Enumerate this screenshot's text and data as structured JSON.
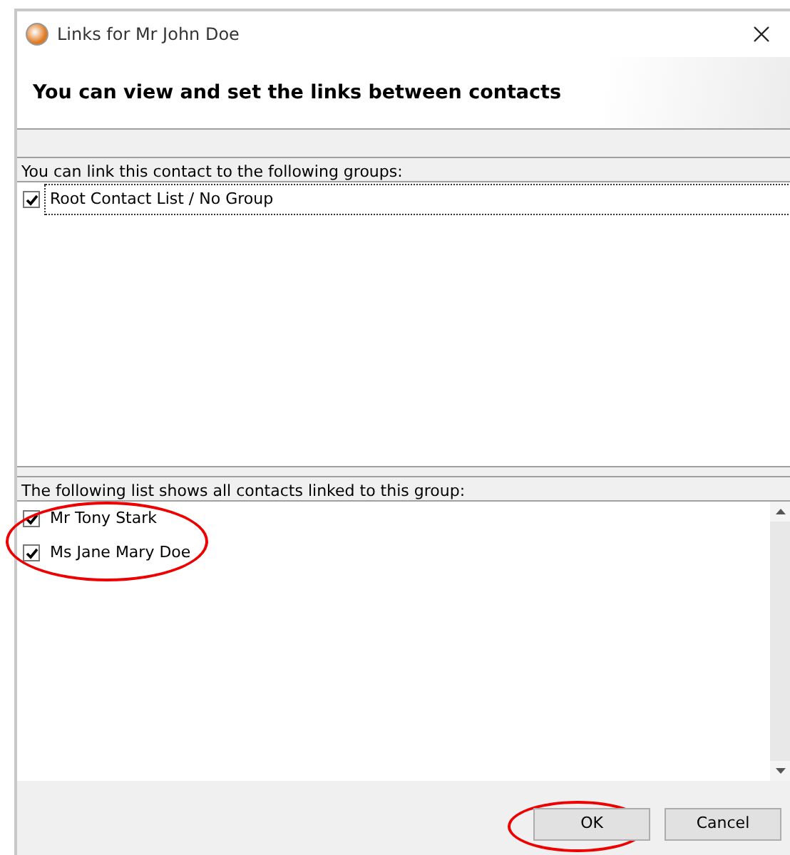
{
  "window": {
    "title": "Links for Mr John Doe"
  },
  "header": {
    "title": "You can view and set the links between contacts"
  },
  "groups": {
    "label": "You can link this contact to the following groups:",
    "items": [
      {
        "name": "Root Contact List / No Group",
        "checked": true,
        "selected": true
      }
    ]
  },
  "contacts": {
    "label": "The following list shows all contacts linked to this group:",
    "circled": true,
    "items": [
      {
        "name": "Mr Tony Stark",
        "checked": true
      },
      {
        "name": "Ms Jane Mary Doe",
        "checked": true
      }
    ]
  },
  "buttons": [
    {
      "label": "OK",
      "circled": true
    },
    {
      "label": "Cancel",
      "circled": false
    }
  ]
}
